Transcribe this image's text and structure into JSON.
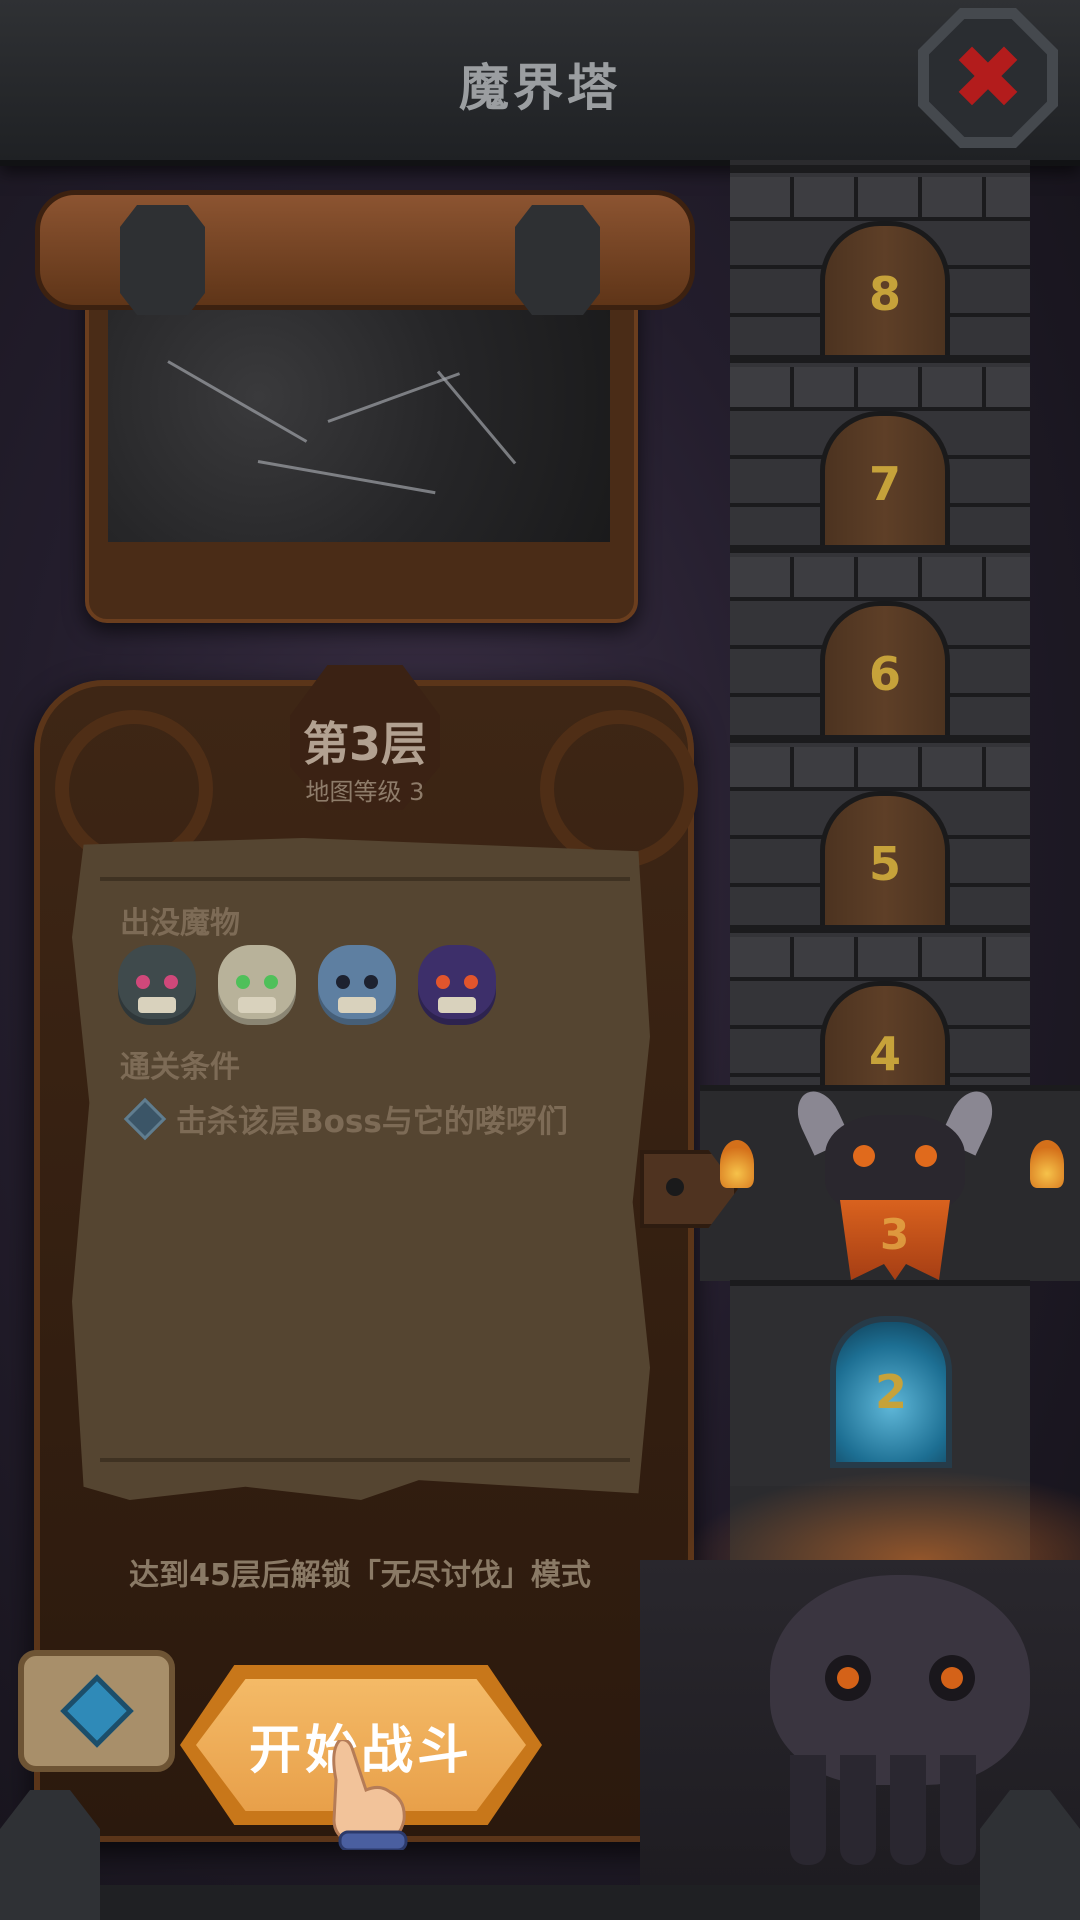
{
  "header": {
    "title": "魔界塔",
    "close_icon": "close-x-icon"
  },
  "stage": {
    "level_title": "第3层",
    "map_level": "地图等级 3"
  },
  "monsters": {
    "label": "出没魔物",
    "list": [
      {
        "name": "one-eyed-ogre-icon",
        "color": "#3f4a4c",
        "eye": "#d0487a"
      },
      {
        "name": "skull-icon",
        "color": "#b8b29a",
        "eye": "#4fc05a"
      },
      {
        "name": "zombie-icon",
        "color": "#5e7fa1",
        "eye": "#1d2230"
      },
      {
        "name": "bat-demon-icon",
        "color": "#3d2f6a",
        "eye": "#e2552c"
      }
    ]
  },
  "conditions": {
    "label": "通关条件",
    "items": [
      "击杀该层Boss与它的喽啰们"
    ]
  },
  "unlock_note": "达到45层后解锁「无尽讨伐」模式",
  "start_button": {
    "label": "开始战斗"
  },
  "tower": {
    "floors": [
      "8",
      "7",
      "6",
      "5",
      "4"
    ],
    "current_floor": "3",
    "next_floor": "2"
  },
  "colors": {
    "accent": "#e8a04a",
    "floor_number": "#c6a23a",
    "danger": "#b31c1c"
  }
}
